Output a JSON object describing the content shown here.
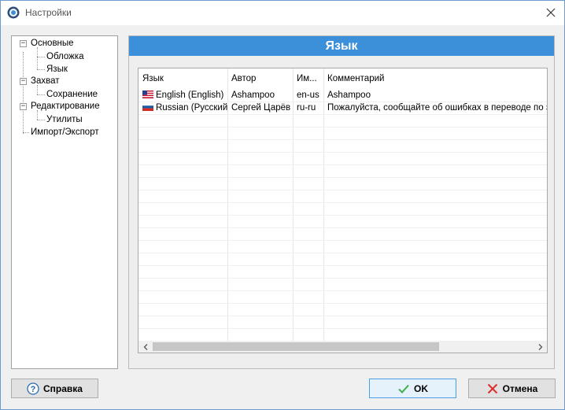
{
  "window": {
    "title": "Настройки"
  },
  "tree": {
    "items": [
      {
        "label": "Основные"
      },
      {
        "label": "Обложка"
      },
      {
        "label": "Язык"
      },
      {
        "label": "Захват"
      },
      {
        "label": "Сохранение"
      },
      {
        "label": "Редактирование"
      },
      {
        "label": "Утилиты"
      },
      {
        "label": "Импорт/Экспорт"
      }
    ]
  },
  "panel": {
    "header": "Язык"
  },
  "table": {
    "columns": [
      "Язык",
      "Автор",
      "Им...",
      "Комментарий"
    ],
    "rows": [
      {
        "flag": "us-flag-icon",
        "language": "English (English)",
        "author": "Ashampoo",
        "code": "en-us",
        "comment": "Ashampoo"
      },
      {
        "flag": "ru-flag-icon",
        "language": "Russian (Русский)",
        "author": "Сергей Царёв",
        "code": "ru-ru",
        "comment": "Пожалуйста, сообщайте об ошибках в переводе по эл"
      }
    ]
  },
  "buttons": {
    "help": "Справка",
    "ok": "OK",
    "cancel": "Отмена"
  },
  "colors": {
    "header": "#3c8fd9",
    "ok_border": "#4aa0e6",
    "cancel_icon": "#d9302c",
    "ok_icon": "#3fae49"
  }
}
